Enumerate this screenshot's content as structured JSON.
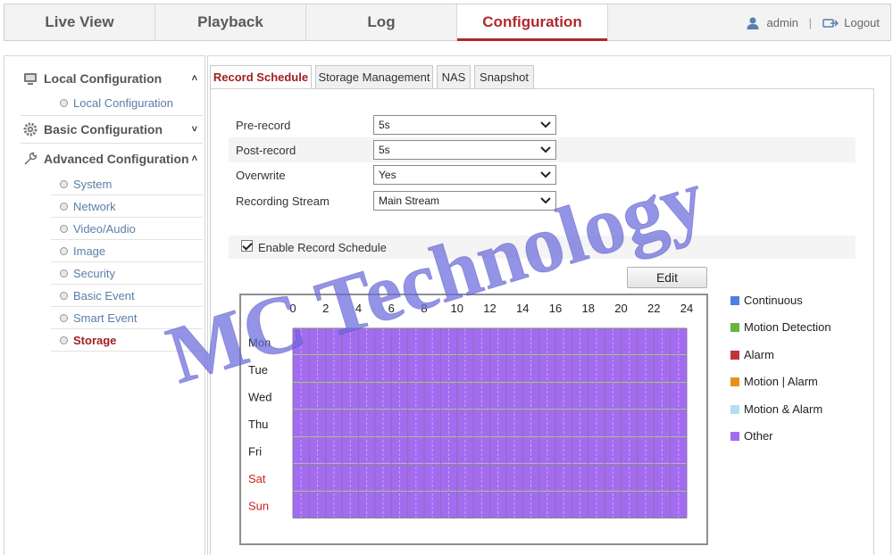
{
  "nav": {
    "live_view": "Live View",
    "playback": "Playback",
    "log": "Log",
    "configuration": "Configuration",
    "user": "admin",
    "separator": "|",
    "logout": "Logout"
  },
  "sidebar": {
    "local": {
      "title": "Local Configuration",
      "items": [
        "Local Configuration"
      ]
    },
    "basic": {
      "title": "Basic Configuration"
    },
    "advanced": {
      "title": "Advanced Configuration",
      "items": [
        "System",
        "Network",
        "Video/Audio",
        "Image",
        "Security",
        "Basic Event",
        "Smart Event",
        "Storage"
      ]
    }
  },
  "tabs": [
    "Record Schedule",
    "Storage Management",
    "NAS",
    "Snapshot"
  ],
  "form": {
    "pre_record": {
      "label": "Pre-record",
      "value": "5s"
    },
    "post_record": {
      "label": "Post-record",
      "value": "5s"
    },
    "overwrite": {
      "label": "Overwrite",
      "value": "Yes"
    },
    "recording_stream": {
      "label": "Recording Stream",
      "value": "Main Stream"
    },
    "enable_schedule": {
      "label": "Enable Record Schedule",
      "checked": true
    },
    "edit": "Edit"
  },
  "schedule": {
    "hours": [
      "0",
      "2",
      "4",
      "6",
      "8",
      "10",
      "12",
      "14",
      "16",
      "18",
      "20",
      "22",
      "24"
    ],
    "days": [
      "Mon",
      "Tue",
      "Wed",
      "Thu",
      "Fri",
      "Sat",
      "Sun"
    ],
    "weekend_color": "#cc2222",
    "fill_color": "#a36bf0",
    "fill_type": "Other"
  },
  "legend": [
    {
      "label": "Continuous",
      "color": "#4f7fe0"
    },
    {
      "label": "Motion Detection",
      "color": "#66b544"
    },
    {
      "label": "Alarm",
      "color": "#c0343b"
    },
    {
      "label": "Motion | Alarm",
      "color": "#e8901c"
    },
    {
      "label": "Motion & Alarm",
      "color": "#b5def5"
    },
    {
      "label": "Other",
      "color": "#a36bf0"
    }
  ],
  "watermark": "MC Technology",
  "colors": {
    "accent": "#b1282b",
    "active_sidebar": "#a01f22",
    "link": "#5b7ea8"
  }
}
